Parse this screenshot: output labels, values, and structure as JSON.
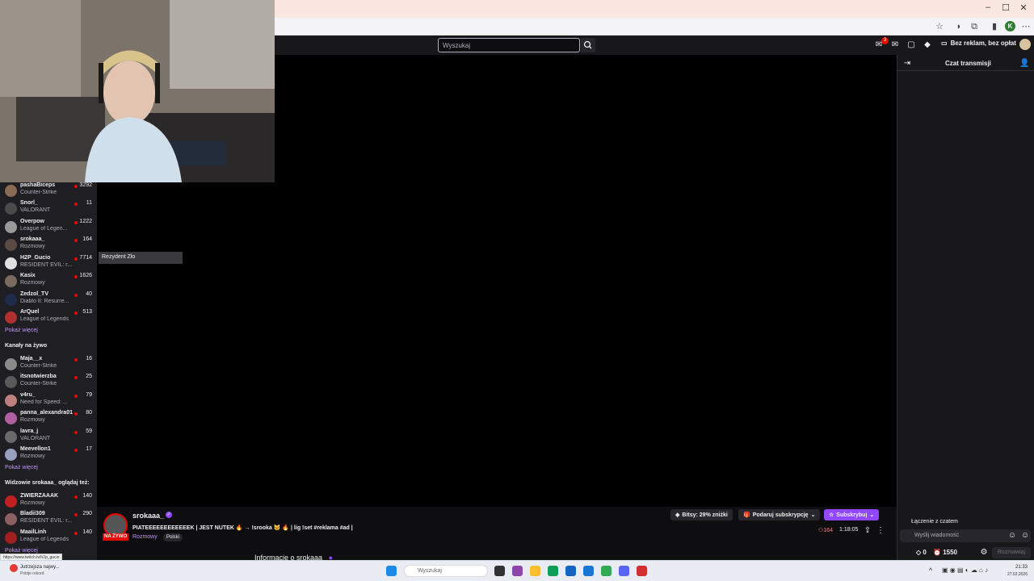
{
  "browser": {
    "window_controls": [
      "–",
      "☐",
      "✕"
    ]
  },
  "twitch_nav": {
    "search_placeholder": "Wyszukaj",
    "notification_count": "3",
    "adfree_label": "Bez reklam, bez opłat"
  },
  "sidebar": {
    "followed": [
      {
        "name": "pashaBiceps",
        "game": "Counter-Strike",
        "viewers": "3292",
        "color": "#8a6b55"
      },
      {
        "name": "Snorl_",
        "game": "VALORANT",
        "viewers": "11",
        "color": "#4a4a4a"
      },
      {
        "name": "Overpow",
        "game": "League of Legen...",
        "viewers": "1222",
        "color": "#9a9a9a"
      },
      {
        "name": "srokaaa_",
        "game": "Rozmowy",
        "viewers": "164",
        "color": "#5a4a44"
      },
      {
        "name": "H2P_Gucio",
        "game": "RESIDENT EVIL: r...",
        "viewers": "7714",
        "color": "#e0e0e0"
      },
      {
        "name": "Kasix",
        "game": "Rozmowy",
        "viewers": "1626",
        "color": "#7a6a60"
      },
      {
        "name": "Zedzol_TV",
        "game": "Diablo II: Resurre...",
        "viewers": "40",
        "color": "#1d2a4a"
      },
      {
        "name": "ArQuel",
        "game": "League of Legends",
        "viewers": "513",
        "color": "#b03030"
      }
    ],
    "show_more_1": "Pokaż więcej",
    "live_section_title": "Kanały na żywo",
    "live": [
      {
        "name": "Maja__x",
        "game": "Counter-Strike",
        "viewers": "16",
        "color": "#8a8a8a"
      },
      {
        "name": "itsnotwierzba",
        "game": "Counter-Strike",
        "viewers": "25",
        "color": "#5a5a5a"
      },
      {
        "name": "v4ru_",
        "game": "Need for Speed: ...",
        "viewers": "79",
        "color": "#c08080"
      },
      {
        "name": "panna_alexandra01",
        "game": "Rozmowy",
        "viewers": "80",
        "color": "#b060a0"
      },
      {
        "name": "lavra_j",
        "game": "VALORANT",
        "viewers": "59",
        "color": "#6a6a6a"
      },
      {
        "name": "Meevellon1",
        "game": "Rozmowy",
        "viewers": "17",
        "color": "#9aa0c0"
      }
    ],
    "show_more_2": "Pokaż więcej",
    "also_watch_title": "Widzowie srokaaa_ oglądaj też:",
    "also_watch": [
      {
        "name": "ZWIERZAAAK",
        "game": "Rozmowy",
        "viewers": "140",
        "color": "#c02020"
      },
      {
        "name": "Bladii309",
        "game": "RESIDENT EVIL: r...",
        "viewers": "290",
        "color": "#8a6060"
      },
      {
        "name": "MaailLinh",
        "game": "League of Legends",
        "viewers": "140",
        "color": "#a02020"
      }
    ],
    "show_more_3": "Pokaż więcej",
    "url_hint": "https://www.twitch.tv/h2p_gucio"
  },
  "tooltip": "Rezydent Zło",
  "stream": {
    "streamer": "srokaaa_",
    "live_label": "NA ŻYWO",
    "title": "PIATEEEEEEEEEEEEK | JEST NUTEK 🔥 → !srooka 🐱 🔥 | lig !set #reklama #ad |",
    "category": "Rozmowy",
    "language_tag": "Polski",
    "bits_label": "Bitsy: 29% zniżki",
    "gift_sub_label": "Podaruj subskrypcję",
    "subscribe_label": "Subskrybuj",
    "viewers": "164",
    "uptime": "1:18:05",
    "about_label": "Informacje o srokaaa_"
  },
  "chat": {
    "title": "Czat transmisji",
    "connecting": "Łączenie z czatem",
    "input_placeholder": "Wyślij wiadomość",
    "points_a": "0",
    "points_b": "1550",
    "send_label": "Rozmawiaj"
  },
  "taskbar": {
    "weather_title": "Jutrzejsza najwy...",
    "weather_sub": "Pobije rekord",
    "search_placeholder": "Wyszukaj",
    "time": "21:33",
    "date": "27.02.2026",
    "accent": "#9147ff"
  }
}
